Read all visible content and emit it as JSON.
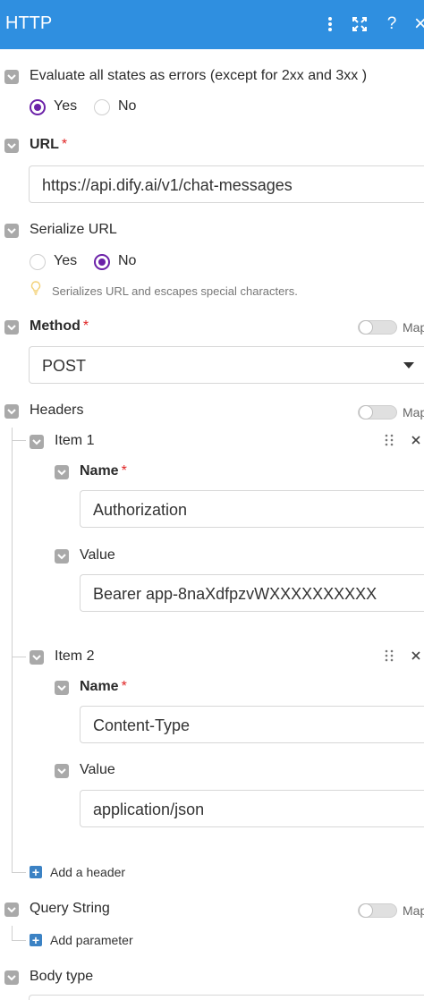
{
  "header": {
    "title": "HTTP",
    "icons": [
      "more-vertical-icon",
      "fullscreen-icon",
      "help-icon",
      "close-icon"
    ],
    "help_glyph": "?",
    "close_glyph": "×",
    "background": "#2f8fe0"
  },
  "evaluate_errors": {
    "label": "Evaluate all states as errors (except for 2xx and 3xx )",
    "options": [
      {
        "label": "Yes",
        "selected": true
      },
      {
        "label": "No",
        "selected": false
      }
    ]
  },
  "url": {
    "label": "URL",
    "required_mark": "*",
    "value": "https://api.dify.ai/v1/chat-messages"
  },
  "serialize_url": {
    "label": "Serialize URL",
    "options": [
      {
        "label": "Yes",
        "selected": false
      },
      {
        "label": "No",
        "selected": true
      }
    ],
    "hint": "Serializes URL and escapes special characters."
  },
  "method": {
    "label": "Method",
    "required_mark": "*",
    "value": "POST",
    "map_label": "Map"
  },
  "headers": {
    "label": "Headers",
    "map_label": "Map",
    "items": [
      {
        "title": "Item 1",
        "name_label": "Name",
        "name_value": "Authorization",
        "value_label": "Value",
        "value_value": "Bearer app-8naXdfpzvWXXXXXXXXXX"
      },
      {
        "title": "Item 2",
        "name_label": "Name",
        "name_value": "Content-Type",
        "value_label": "Value",
        "value_value": "application/json"
      }
    ],
    "required_mark": "*",
    "add_label": "Add a header"
  },
  "query_string": {
    "label": "Query String",
    "map_label": "Map",
    "add_label": "Add parameter"
  },
  "body_type": {
    "label": "Body type"
  },
  "colors": {
    "accent_purple": "#6b21a8",
    "required_red": "#e02424",
    "checkbox_gray": "#a9a9a9",
    "plus_blue": "#3b82c4"
  }
}
